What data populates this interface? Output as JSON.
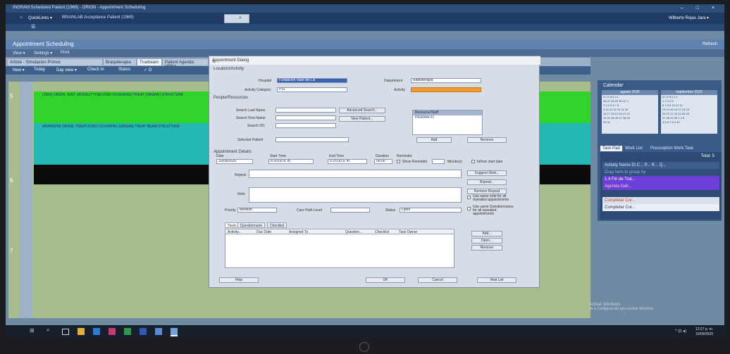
{
  "window": {
    "title": "INGRAM Scheduled Patient (1969) - ORION - Appointment Scheduling",
    "controls": "– □ ×"
  },
  "appbar": {
    "quicklinks": "QuickLinks ▾",
    "patient": "BRAINLAB Acceptance Patient (1969)",
    "user": "Wilberto Rojas Jara ▾"
  },
  "module": {
    "title": "Appointment Scheduling",
    "refresh": "Refresh"
  },
  "module_tools": {
    "view": "View ▾",
    "settings": "Settings ▾",
    "print": "Print"
  },
  "tabs": [
    "Artiste - Simulacion Primus",
    "Braquiterapia",
    "Truebeam",
    "Patient Agenda: VERA"
  ],
  "toolbar": {
    "new": "New ▾",
    "today": "Today",
    "dayview": "Day view ▾",
    "checkin": "Check In",
    "status": "Status",
    "ok": "✓ O"
  },
  "schedule": {
    "hours": [
      "5",
      "6",
      "7"
    ],
    "green_text": "(1969) ORION, IMRT, MODALITY(SECOND COVERING) TREAT (ORGAN) STRUCTURE",
    "teal_text": "(ANIMSPM) ORION, TREAT(ICN)G COVERING (ORGAN) TREAT BEAM STRUCTURE"
  },
  "calendar": {
    "title": "Calendar",
    "month1": "agosto 2020",
    "month2": "septiembre 2020",
    "weekdays": "d l m m j v s",
    "weeks1": [
      "26 27 28 29 30 31 1",
      "2 3 4 5 6 7 8",
      "9 10 11 12 13 14 15",
      "16 17 18 19 20 21 22",
      "23 24 25 26 27 28 29",
      "30 31"
    ],
    "weeks2": [
      "1 2 3 4 5",
      "6 7 8 9 10 11 12",
      "13 14 15 16 17 18 19",
      "20 21 22 23 24 25 26",
      "27 28 29 30 1 2 3",
      "4 5 6 7 8 9 10"
    ]
  },
  "taskpad": {
    "tabs": [
      "Task Pad",
      "Work List",
      "Prescription Work Task"
    ],
    "total": "Total: 5",
    "columns": "Activity Name  Et  C...  P...  R...  Q...",
    "group": "Drag here to group by",
    "rows": [
      "1.4 Fin de Trat...",
      "Agenda Gafi...",
      "Completar Cur...",
      "Completar Cur..."
    ]
  },
  "dialog": {
    "title": "Appointment Dialog",
    "sec_location": "Location/Activity",
    "hospital_label": "Hospital",
    "hospital_value": "Fundacion Valle del Lili",
    "department_label": "Department",
    "department_value": "Radioterapia",
    "activity_category_label": "Activity Category",
    "activity_category_value": "PSI",
    "activity_label": "Activity",
    "sec_people": "People/Resources",
    "search_last": "Search Last Name",
    "search_first": "Search First Name",
    "search_id": "Search ID1",
    "advanced_search": "Advanced Search...",
    "new_patient": "New Patient...",
    "resource_header": "Resource/Staff",
    "resource_value": "INGRAM-01",
    "selected_patient": "Selected Patient",
    "add": "Add",
    "remove": "Remove",
    "sec_details": "Appointment Details",
    "date_label": "Date",
    "date_value": "10/09/2020",
    "start_label": "Start Time",
    "start_value": "6:20:00 a. m.",
    "end_label": "End Time",
    "end_value": "6:25:00 a. m.",
    "duration_label": "Duration",
    "duration_value": "00:05",
    "reminder_label": "Reminder",
    "show_reminder": "Show Reminder",
    "minutes": "Minute(s)",
    "before_start": "before start date",
    "repeat_label": "Repeat",
    "suggest_slots": "Suggest Slots...",
    "repeat_btn": "Repeat...",
    "note_label": "Note",
    "remove_repeat": "Remove Repeat",
    "use_same_note": "Use same note for all repeated appointments",
    "priority_label": "Priority",
    "priority_value": "Medium",
    "care_path": "Care Path Level",
    "status_label": "Status",
    "status_value": "Open",
    "use_same_quest": "Use same Questionnaires for all repeated appointments",
    "subtabs": [
      "Tasks",
      "Questionnaire",
      "Checklist"
    ],
    "task_cols": [
      "Activity...",
      "Due Date",
      "Assigned To",
      "Question...",
      "Checklist",
      "Task Owner"
    ],
    "task_add": "Add...",
    "task_open": "Open...",
    "task_remove": "Remove",
    "help": "Help",
    "ok": "OK",
    "cancel": "Cancel",
    "waitlist": "Wait List"
  },
  "desktop": {
    "watermark_1": "Activar Windows",
    "watermark_2": "Ve a Configuración para activar Windows.",
    "time": "12:27 p. m.",
    "date": "10/09/2020"
  },
  "colors": {
    "green": "#30d42b",
    "teal": "#25b7b3",
    "orange": "#f19e32",
    "purple": "#6b3fd8"
  }
}
